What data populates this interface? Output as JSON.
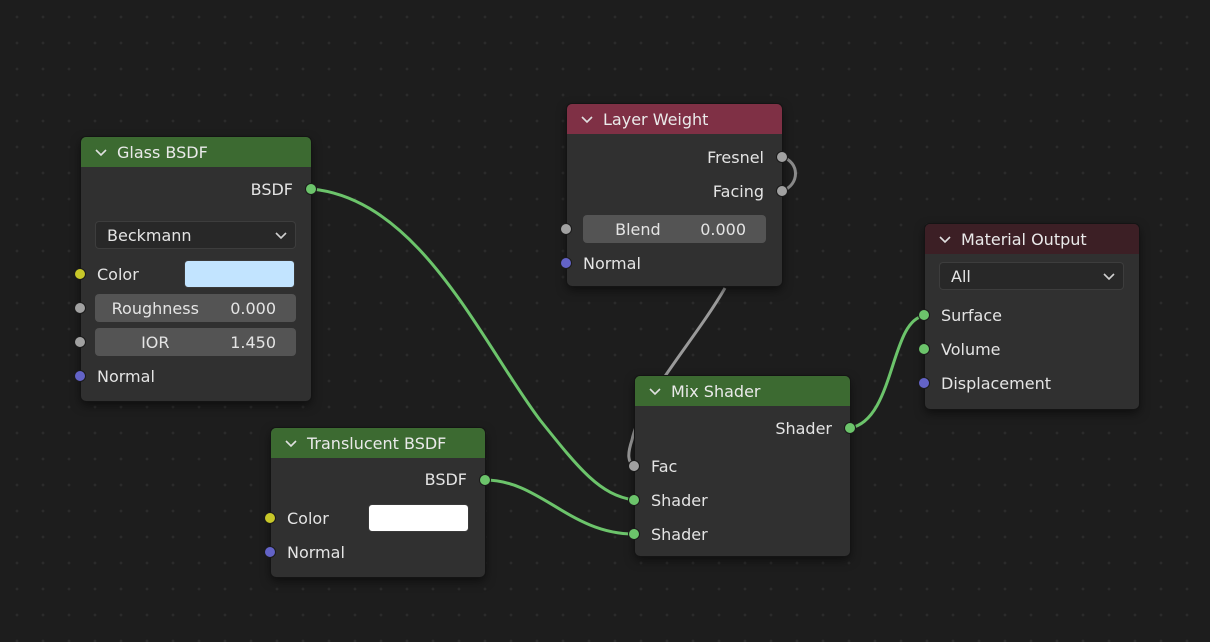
{
  "colors": {
    "shader_socket": "#6cc46b",
    "float_socket": "#a1a1a1",
    "color_socket": "#c7c729",
    "vector_socket": "#6363c7",
    "shader_header": "#3c6a31",
    "input_header": "#7f3045",
    "output_header": "#3c1f25",
    "glass_color": "#c2e4ff",
    "translucent_color": "#ffffff"
  },
  "glass": {
    "title": "Glass BSDF",
    "out": "BSDF",
    "distribution": "Beckmann",
    "color_label": "Color",
    "roughness_label": "Roughness",
    "roughness_value": "0.000",
    "ior_label": "IOR",
    "ior_value": "1.450",
    "normal_label": "Normal"
  },
  "layer_weight": {
    "title": "Layer Weight",
    "fresnel": "Fresnel",
    "facing": "Facing",
    "blend_label": "Blend",
    "blend_value": "0.000",
    "normal_label": "Normal"
  },
  "material_output": {
    "title": "Material Output",
    "target": "All",
    "surface": "Surface",
    "volume": "Volume",
    "displacement": "Displacement"
  },
  "translucent": {
    "title": "Translucent BSDF",
    "out": "BSDF",
    "color_label": "Color",
    "normal_label": "Normal"
  },
  "mix": {
    "title": "Mix Shader",
    "out": "Shader",
    "fac": "Fac",
    "shader1": "Shader",
    "shader2": "Shader"
  }
}
